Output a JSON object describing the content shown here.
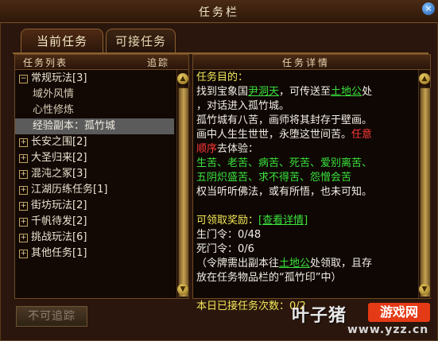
{
  "window": {
    "title": "任务栏",
    "close_icon": "×"
  },
  "tabs": [
    {
      "label": "当前任务",
      "active": true
    },
    {
      "label": "可接任务",
      "active": false
    }
  ],
  "task_list": {
    "header_left": "任务列表",
    "header_right": "追踪",
    "items": [
      {
        "toggle": "−",
        "label": "常规玩法[3]",
        "level": 0
      },
      {
        "toggle": "",
        "label": "域外风情",
        "level": 1
      },
      {
        "toggle": "",
        "label": "心性修炼",
        "level": 1
      },
      {
        "toggle": "",
        "label": "经验副本：孤竹城",
        "level": 1,
        "selected": true
      },
      {
        "toggle": "+",
        "label": "长安之围[2]",
        "level": 0
      },
      {
        "toggle": "+",
        "label": "大圣归来[2]",
        "level": 0
      },
      {
        "toggle": "+",
        "label": "混沌之冢[3]",
        "level": 0
      },
      {
        "toggle": "+",
        "label": "江湖历练任务[1]",
        "level": 0
      },
      {
        "toggle": "+",
        "label": "街坊玩法[2]",
        "level": 0
      },
      {
        "toggle": "+",
        "label": "千帆待发[2]",
        "level": 0
      },
      {
        "toggle": "+",
        "label": "挑战玩法[6]",
        "level": 0
      },
      {
        "toggle": "+",
        "label": "其他任务[1]",
        "level": 0
      }
    ]
  },
  "detail": {
    "header": "任务详情",
    "goal_title": "任务目的：",
    "goal_p1a": "找到宝象国",
    "npc1": "尹洞天",
    "goal_p1b": "，可传送至",
    "npc2": "土地公",
    "goal_p1c": "处",
    "goal_p2": "，对话进入孤竹城。",
    "story1": "孤竹城有八苦，画师将其封存于壁画。",
    "story2a": "画中人生生世世，永堕这世间苦。",
    "story2b": "任意",
    "story3a": "顺序",
    "story3b": "去体验：",
    "suffer1": "生苦、老苦、病苦、死苦、爱别离苦、",
    "suffer2": "五阴炽盛苦、求不得苦、怨憎会苦",
    "story4": "权当听听佛法，或有所悟，也未可知。",
    "reward_title": "可领取奖励：",
    "reward_link": "[查看详情]",
    "item1": "生门令：0/48",
    "item2": "死门令：0/6",
    "note1a": "（令牌需出副本往",
    "note_npc": "土地公",
    "note1b": "处领取，且存",
    "note2": "放在任务物品栏的“孤竹印”中）",
    "daily": "本日已接任务次数：0/2"
  },
  "buttons": {
    "untrackable": "不可追踪"
  },
  "scroll_icons": {
    "up": "▲",
    "down": "▼"
  },
  "watermark": {
    "cn": "叶子猪",
    "badge": "游戏网",
    "url": "www.yzz.cn"
  },
  "colors": {
    "npc_link": "#39e23d",
    "title_yellow": "#f3e85a",
    "warning_red": "#ff3a3a",
    "selected_row": "#5b5b5b"
  }
}
